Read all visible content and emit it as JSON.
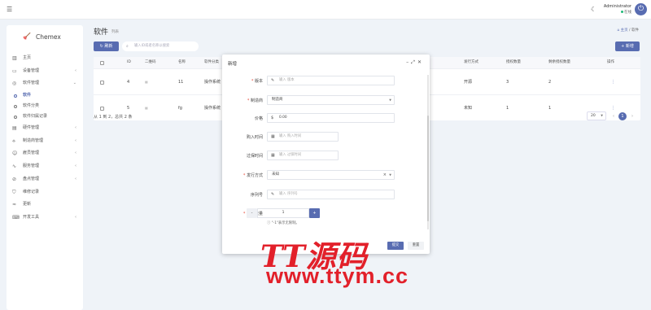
{
  "topbar": {
    "admin_name": "Administrator",
    "admin_status": "在线",
    "hamburger_icon": "menu-icon",
    "theme_icon": "moon-icon",
    "power_icon": "power-icon"
  },
  "sidebar": {
    "brand": "Chemex",
    "items": [
      {
        "label": "主页",
        "icon": "chart-icon",
        "arrow": false
      },
      {
        "label": "设备管理",
        "icon": "monitor-icon",
        "arrow": true
      },
      {
        "label": "软件管理",
        "icon": "disc-icon",
        "arrow": true,
        "expanded": true
      },
      {
        "label": "硬件管理",
        "icon": "server-icon",
        "arrow": true
      },
      {
        "label": "制造商管理",
        "icon": "link-icon",
        "arrow": true
      },
      {
        "label": "雇员管理",
        "icon": "users-icon",
        "arrow": true
      },
      {
        "label": "服务管理",
        "icon": "activity-icon",
        "arrow": true
      },
      {
        "label": "盘点管理",
        "icon": "check-icon",
        "arrow": true
      },
      {
        "label": "维修记录",
        "icon": "shield-icon",
        "arrow": false
      },
      {
        "label": "更新",
        "icon": "sliders-icon",
        "arrow": false
      },
      {
        "label": "开发工具",
        "icon": "keyboard-icon",
        "arrow": true
      }
    ],
    "sub_items": [
      {
        "label": "软件",
        "active": true
      },
      {
        "label": "软件分类",
        "active": false
      },
      {
        "label": "软件归属记录",
        "active": false
      }
    ]
  },
  "header": {
    "title": "软件",
    "subtitle": "列表",
    "breadcrumb_home": "主页",
    "breadcrumb_current": "软件"
  },
  "toolbar": {
    "refresh_label": "刷新",
    "search_placeholder": "输入ID或者名称以搜索",
    "add_label": "新增"
  },
  "table": {
    "columns": [
      "ID",
      "二维码",
      "名称",
      "软件分类",
      "发行方式",
      "授权数量",
      "剩余授权数量",
      "操作"
    ],
    "rows": [
      {
        "id": "4",
        "name": "11",
        "category": "操作系统",
        "distribution": "开源",
        "licenses": "3",
        "remaining": "2",
        "action": "⋮"
      },
      {
        "id": "5",
        "name": "fg",
        "category": "操作系统",
        "distribution": "未知",
        "licenses": "1",
        "remaining": "1",
        "action": "⋮"
      }
    ],
    "page_info": "从 1 到 2，总共 2 条",
    "page_size": "20",
    "current_page": "1"
  },
  "dialog": {
    "title": "新增",
    "version_label": "版本",
    "version_placeholder": "输入 版本",
    "manufacturer_label": "制造商",
    "manufacturer_value": "制造商",
    "price_label": "价格",
    "price_value": "0.00",
    "price_prefix": "$",
    "purchased_label": "购入时间",
    "purchased_placeholder": "输入 购入时间",
    "expired_label": "过保时间",
    "expired_placeholder": "输入 过保时间",
    "distribution_label": "发行方式",
    "distribution_value": "未知",
    "serial_label": "序列号",
    "serial_placeholder": "输入 序列号",
    "counts_label": "授权数量",
    "counts_value": "1",
    "counts_hint": "\"-1\"表示无限制。",
    "submit_label": "提交",
    "reset_label": "重置"
  },
  "watermark": {
    "line1": "TT源码",
    "line2": "www.ttym.cc"
  },
  "colors": {
    "primary": "#586cb1",
    "online": "#21b978",
    "watermark": "#e2202a"
  }
}
